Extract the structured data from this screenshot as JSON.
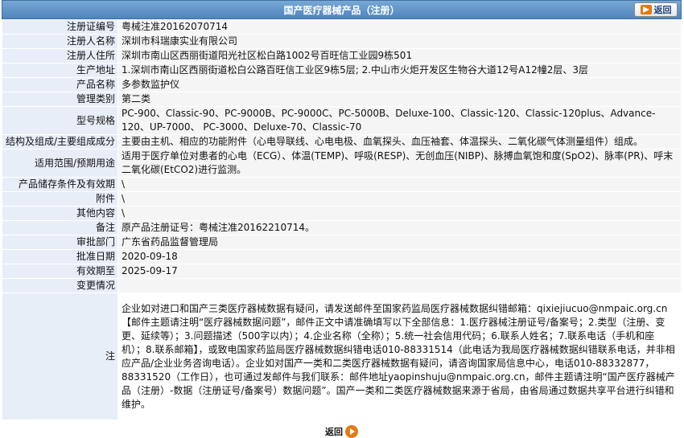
{
  "header": {
    "title": "国产医疗器械产品（注册）",
    "back_label": "返回"
  },
  "rows": [
    {
      "key": "注册证编号",
      "value": "粤械注准20162070714"
    },
    {
      "key": "注册人名称",
      "value": "深圳市科瑞康实业有限公司"
    },
    {
      "key": "注册人住所",
      "value": "深圳市南山区西丽街道阳光社区松白路1002号百旺信工业园9栋501"
    },
    {
      "key": "生产地址",
      "value": "1.深圳市南山区西丽街道松白公路百旺信工业区9栋5层; 2.中山市火炬开发区生物谷大道12号A12幢2层、3层"
    },
    {
      "key": "产品名称",
      "value": "多参数监护仪"
    },
    {
      "key": "管理类别",
      "value": "第二类"
    },
    {
      "key": "型号规格",
      "value": "PC-900、Classic-90、PC-9000B、PC-9000C、PC-5000B、Deluxe-100、Classic-120、Classic-120plus、Advance-120、UP-7000、 PC-3000、Deluxe-70、Classic-70"
    },
    {
      "key": "结构及组成/主要组成成分",
      "value": "主要由主机、相应的功能附件（心电导联线、心电电极、血氧探头、血压袖套、体温探头、二氧化碳气体测量组件）组成。"
    },
    {
      "key": "适用范围/预期用途",
      "value": "适用于医疗单位对患者的心电（ECG）、体温(TEMP)、呼吸(RESP)、无创血压(NIBP)、脉搏血氧饱和度(SpO2)、脉率(PR)、呼末二氧化碳(EtCO2)进行监测。"
    },
    {
      "key": "产品储存条件及有效期",
      "value": "\\"
    },
    {
      "key": "附件",
      "value": "\\"
    },
    {
      "key": "其他内容",
      "value": "\\"
    },
    {
      "key": "备注",
      "value": "原产品注册证号：粤械注准20162210714。"
    },
    {
      "key": "审批部门",
      "value": "广东省药品监督管理局"
    },
    {
      "key": "批准日期",
      "value": "2020-09-18"
    },
    {
      "key": "有效期至",
      "value": "2025-09-17"
    },
    {
      "key": "变更情况",
      "value": ""
    }
  ],
  "note": {
    "key": "注",
    "value": "企业如对进口和国产三类医疗器械数据有疑问，请发送邮件至国家药监局医疗器械数据纠错邮箱：qixiejiucuo@nmpaic.org.cn【邮件主题请注明“医疗器械数据问题”，邮件正文中请准确填写以下全部信息：1.医疗器械注册证号/备案号；2.类型（注册、变更、延续等）；3.问题描述（500字以内）；4.企业名称（全称）；5.统一社会信用代码；6.联系人姓名；7.联系电话（手机和座机）；8.联系邮箱】，或致电国家药监局医疗器械数据纠错电话010-88331514（此电话为我局医疗器械数据纠错联系电话，并非相应产品/企业业务咨询电话）。企业如对国产一类和二类医疗器械数据有疑问，请咨询国家局信息中心，电话010-88332877，88331520（工作日），也可通过发邮件与我们联系：邮件地址yaopinshuju@nmpaic.org.cn，邮件主题请注明“国产医疗器械产品（注册）-数据（注册证号/备案号）数据问题”。国产一类和二类医疗器械数据来源于省局，由省局通过数据共享平台进行纠错和维护。"
  },
  "footer": {
    "back_label": "返回"
  }
}
